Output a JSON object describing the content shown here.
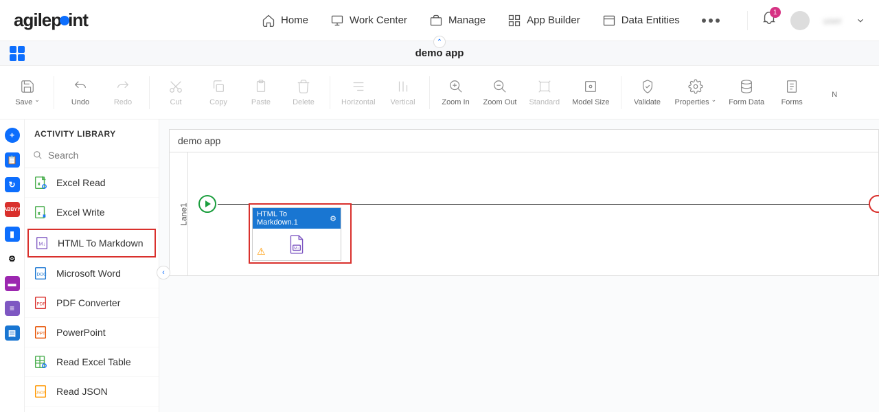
{
  "brand": "agilepoint",
  "nav": {
    "home": "Home",
    "work_center": "Work Center",
    "manage": "Manage",
    "app_builder": "App Builder",
    "data_entities": "Data Entities"
  },
  "notifications": {
    "count": "1"
  },
  "user": {
    "name": "user"
  },
  "titlebar": {
    "app_name": "demo app"
  },
  "toolbar": {
    "save": "Save",
    "undo": "Undo",
    "redo": "Redo",
    "cut": "Cut",
    "copy": "Copy",
    "paste": "Paste",
    "delete": "Delete",
    "horizontal": "Horizontal",
    "vertical": "Vertical",
    "zoom_in": "Zoom In",
    "zoom_out": "Zoom Out",
    "standard": "Standard",
    "model_size": "Model Size",
    "validate": "Validate",
    "properties": "Properties",
    "form_data": "Form Data",
    "forms": "Forms",
    "next_partial": "N"
  },
  "sidebar": {
    "title": "ACTIVITY LIBRARY",
    "search_placeholder": "Search",
    "items": [
      {
        "label": "Excel Read"
      },
      {
        "label": "Excel Write"
      },
      {
        "label": "HTML To Markdown"
      },
      {
        "label": "Microsoft Word"
      },
      {
        "label": "PDF Converter"
      },
      {
        "label": "PowerPoint"
      },
      {
        "label": "Read Excel Table"
      },
      {
        "label": "Read JSON"
      }
    ]
  },
  "canvas": {
    "title": "demo app",
    "lane": "Lane1",
    "activity": {
      "title": "HTML To Markdown.1"
    }
  }
}
